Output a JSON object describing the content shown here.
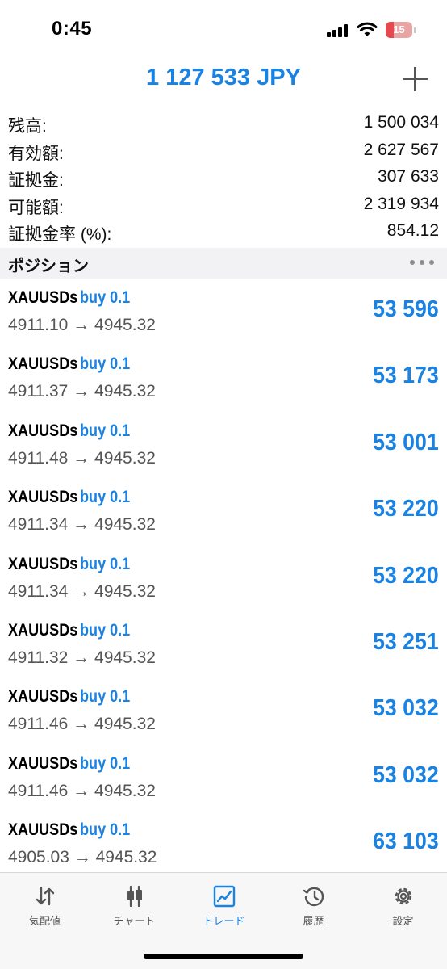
{
  "status_bar": {
    "time": "0:45",
    "battery": "15"
  },
  "header": {
    "balance": "1 127 533 JPY"
  },
  "summary": [
    {
      "label": "残高:",
      "value": "1 500 034"
    },
    {
      "label": "有効額:",
      "value": "2 627 567"
    },
    {
      "label": "証拠金:",
      "value": "307 633"
    },
    {
      "label": "可能額:",
      "value": "2 319 934"
    },
    {
      "label": "証拠金率 (%):",
      "value": "854.12"
    }
  ],
  "section": {
    "title": "ポジション"
  },
  "positions": [
    {
      "symbol": "XAUUSDs",
      "side": "buy 0.1",
      "prices": "4911.10 → 4945.32",
      "profit": "53 596"
    },
    {
      "symbol": "XAUUSDs",
      "side": "buy 0.1",
      "prices": "4911.37 → 4945.32",
      "profit": "53 173"
    },
    {
      "symbol": "XAUUSDs",
      "side": "buy 0.1",
      "prices": "4911.48 → 4945.32",
      "profit": "53 001"
    },
    {
      "symbol": "XAUUSDs",
      "side": "buy 0.1",
      "prices": "4911.34 → 4945.32",
      "profit": "53 220"
    },
    {
      "symbol": "XAUUSDs",
      "side": "buy 0.1",
      "prices": "4911.34 → 4945.32",
      "profit": "53 220"
    },
    {
      "symbol": "XAUUSDs",
      "side": "buy 0.1",
      "prices": "4911.32 → 4945.32",
      "profit": "53 251"
    },
    {
      "symbol": "XAUUSDs",
      "side": "buy 0.1",
      "prices": "4911.46 → 4945.32",
      "profit": "53 032"
    },
    {
      "symbol": "XAUUSDs",
      "side": "buy 0.1",
      "prices": "4911.46 → 4945.32",
      "profit": "53 032"
    },
    {
      "symbol": "XAUUSDs",
      "side": "buy 0.1",
      "prices": "4905.03 → 4945.32",
      "profit": "63 103"
    }
  ],
  "tabs": [
    {
      "label": "気配値",
      "icon": "quotes-arrows-icon"
    },
    {
      "label": "チャート",
      "icon": "candlestick-chart-icon"
    },
    {
      "label": "トレード",
      "icon": "trade-chart-icon"
    },
    {
      "label": "履歴",
      "icon": "history-clock-icon"
    },
    {
      "label": "設定",
      "icon": "settings-gear-icon"
    }
  ],
  "colors": {
    "accent": "#1a82e2",
    "text": "#111111",
    "secondary": "#555555",
    "section_bg": "#f2f2f4",
    "battery_low": "#e5484d"
  }
}
